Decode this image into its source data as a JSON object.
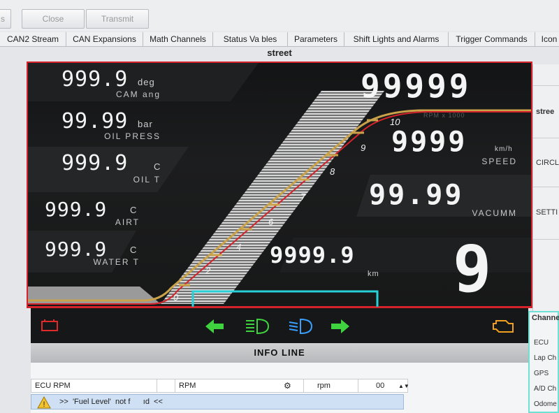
{
  "toolbar": {
    "btn_left": "s",
    "close_label": "Close",
    "transmit_label": "Transmit"
  },
  "tabs": [
    "CAN2 Stream",
    "CAN Expansions",
    "Math Channels",
    "Status Va  bles",
    "Parameters",
    "Shift Lights and Alarms",
    "Trigger Commands",
    "Icon"
  ],
  "page_title": "street",
  "side_panel": {
    "items": [
      "stree",
      "CIRCL",
      "SETTI"
    ]
  },
  "channels_panel": {
    "title": "Channe",
    "items": [
      "ECU",
      "Lap Ch",
      "GPS",
      "A/D Ch",
      "Odome"
    ]
  },
  "dashboard": {
    "colors": {
      "frame": "#d4232b",
      "needle": "#d4232b",
      "gold": "#c9a24a",
      "highlight": "#25d0d6",
      "arrow": "#3fd43f",
      "headlight_high": "#3fd43f",
      "headlight_low": "#3aa0ff",
      "engine": "#f0a020",
      "battery": "#e02a2a"
    },
    "left_readouts": [
      {
        "value": "999.9",
        "unit": "deg",
        "label": "CAM ang"
      },
      {
        "value": "99.99",
        "unit": "bar",
        "label": "OIL PRESS"
      },
      {
        "value": "999.9",
        "unit": "C",
        "label": "OIL T"
      },
      {
        "value": "999.9",
        "unit": "C",
        "label": "AIRT"
      },
      {
        "value": "999.9",
        "unit": "C",
        "label": "WATER T"
      }
    ],
    "rpm": {
      "value": "99999",
      "scale_label": "RPM x 1000",
      "ticks": [
        "0",
        "2",
        "4",
        "6",
        "7",
        "8",
        "9",
        "10"
      ]
    },
    "speed": {
      "value": "9999",
      "unit": "km/h",
      "label": "SPEED"
    },
    "vacuum": {
      "value": "99.99",
      "label": "VACUMM"
    },
    "odometer": {
      "value": "9999.9",
      "unit": "km"
    },
    "gear": "9",
    "icons": {
      "battery": "battery-warning-icon",
      "left": "turn-left-icon",
      "high": "high-beam-icon",
      "low": "low-beam-icon",
      "right": "turn-right-icon",
      "engine": "check-engine-icon"
    },
    "info_line": "INFO LINE"
  },
  "grid": {
    "row": {
      "name": "ECU RPM",
      "channel": "RPM",
      "unit": "rpm",
      "value": "00"
    },
    "warning": ">>  'Fuel Level'  not f      ıd  <<"
  }
}
